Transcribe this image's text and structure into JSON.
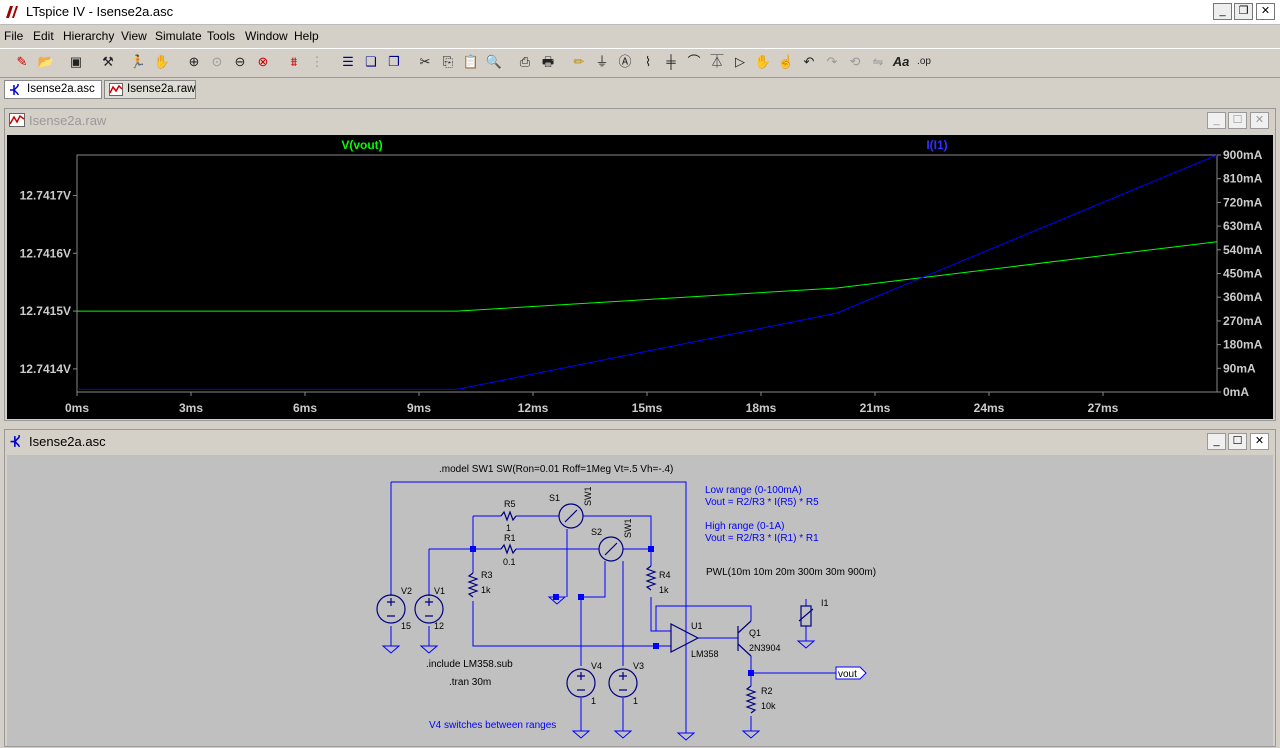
{
  "app": {
    "title": "LTspice IV - Isense2a.asc"
  },
  "menu": [
    "File",
    "Edit",
    "Hierarchy",
    "View",
    "Simulate",
    "Tools",
    "Window",
    "Help"
  ],
  "tabs": [
    "Isense2a.asc",
    "Isense2a.raw"
  ],
  "plot_window": {
    "title": "Isense2a.raw"
  },
  "schematic_window": {
    "title": "Isense2a.asc"
  },
  "chart_data": {
    "type": "line",
    "x_unit": "ms",
    "x_ticks": [
      "0ms",
      "3ms",
      "6ms",
      "9ms",
      "12ms",
      "15ms",
      "18ms",
      "21ms",
      "24ms",
      "27ms"
    ],
    "xlim": [
      0,
      30
    ],
    "y_left_ticks": [
      "12.7417V",
      "12.7416V",
      "12.7415V",
      "12.7414V"
    ],
    "y_left_lim": [
      12.74136,
      12.74177
    ],
    "y_right_ticks": [
      "900mA",
      "810mA",
      "720mA",
      "630mA",
      "540mA",
      "450mA",
      "360mA",
      "270mA",
      "180mA",
      "90mA",
      "0mA"
    ],
    "y_right_lim": [
      0,
      900
    ],
    "series": [
      {
        "name": "V(vout)",
        "color": "#00ff00",
        "axis": "left",
        "x": [
          0,
          10,
          20,
          30
        ],
        "y": [
          12.7415,
          12.7415,
          12.74154,
          12.74162
        ]
      },
      {
        "name": "I(I1)",
        "color": "#0000ff",
        "axis": "right",
        "x": [
          0,
          10,
          20,
          30
        ],
        "y": [
          10,
          10,
          300,
          900
        ]
      }
    ]
  },
  "schematic": {
    "model_directive": ".model SW1 SW(Ron=0.01 Roff=1Meg Vt=.5 Vh=-.4)",
    "note_low_title": "Low range (0-100mA)",
    "note_low_eq": "Vout = R2/R3 * I(R5) * R5",
    "note_high_title": "High range (0-1A)",
    "note_high_eq": "Vout = R2/R3 * I(R1) * R1",
    "pwl": "PWL(10m 10m 20m 300m 30m 900m)",
    "include": ".include LM358.sub",
    "tran": ".tran 30m",
    "comment": "V4 switches between ranges",
    "labels": {
      "R5": "R5",
      "R5v": "1",
      "R1": "R1",
      "R1v": "0.1",
      "R3": "R3",
      "R3v": "1k",
      "R4": "R4",
      "R4v": "1k",
      "R2": "R2",
      "R2v": "10k",
      "V1": "V1",
      "V1v": "12",
      "V2": "V2",
      "V2v": "15",
      "V3": "V3",
      "V3v": "1",
      "V4": "V4",
      "V4v": "1",
      "S1": "S1",
      "S2": "S2",
      "SW1a": "SW1",
      "SW1b": "SW1",
      "U1": "U1",
      "U1v": "LM358",
      "Q1": "Q1",
      "Q1v": "2N3904",
      "I1": "I1",
      "vout": "vout"
    }
  }
}
